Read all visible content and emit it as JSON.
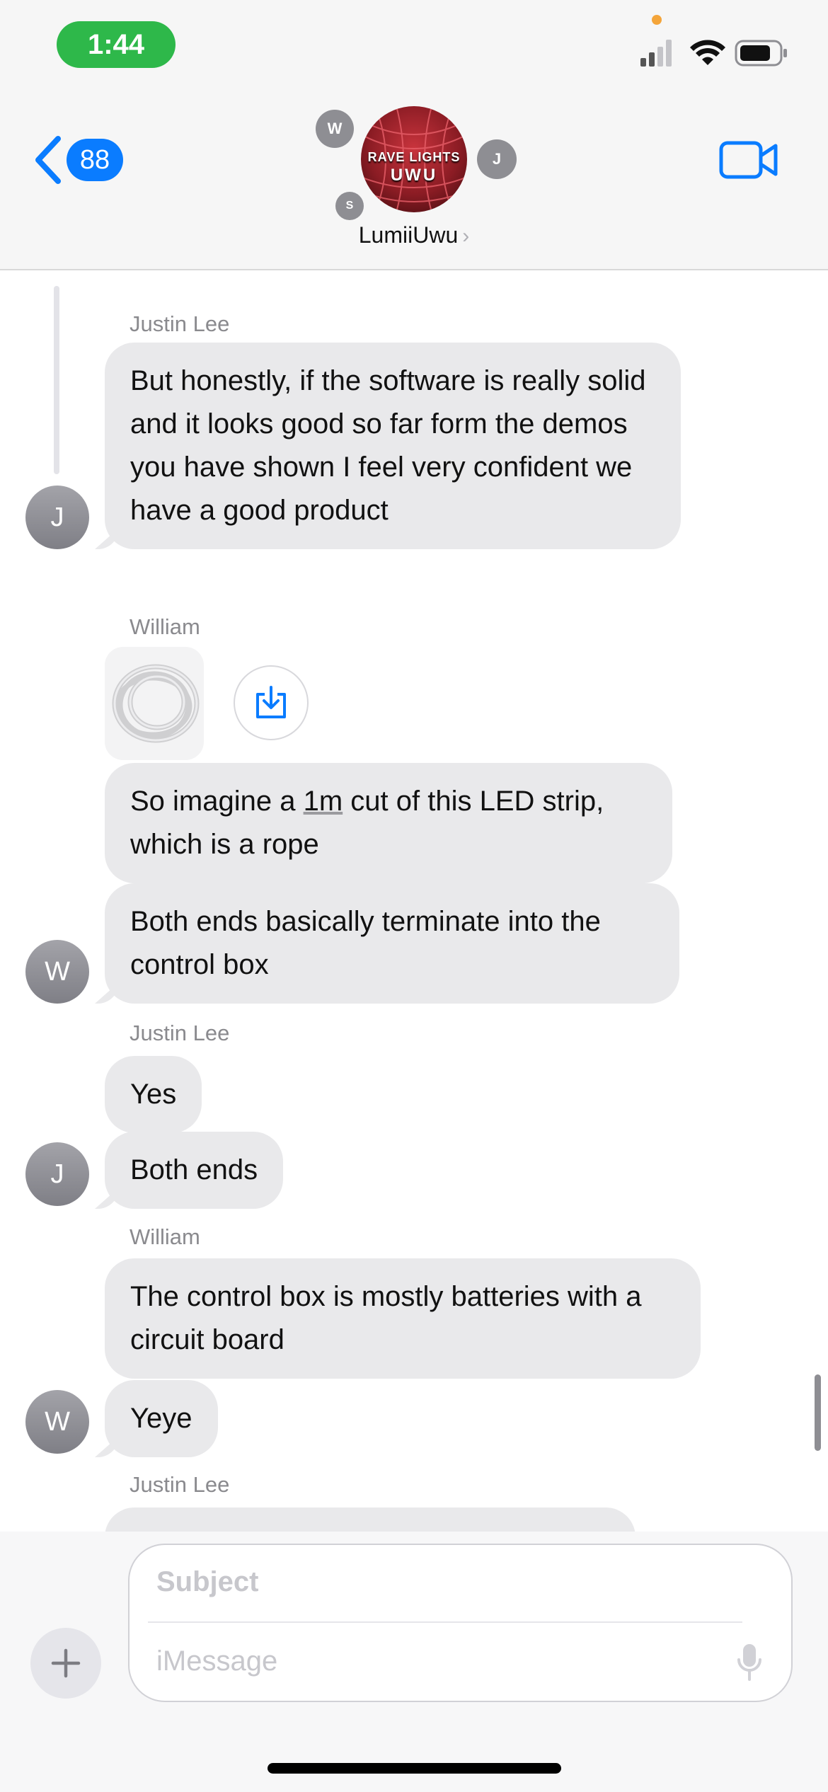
{
  "status_bar": {
    "time": "1:44"
  },
  "header": {
    "back_badge": "88",
    "group_name": "LumiiUwu",
    "group_avatar_line1": "RAVE LIGHTS",
    "group_avatar_line2": "UWU",
    "member_initials": [
      "W",
      "J",
      "S"
    ]
  },
  "messages": {
    "m1": {
      "sender": "Justin Lee",
      "text": "But honestly, if the software is really solid and it looks good so far form the demos you have shown I feel very confident we have a good product",
      "avatar": "J"
    },
    "m2": {
      "sender": "William",
      "text_before": "So imagine a ",
      "text_under": "1m",
      "text_after": " cut of this LED strip, which is a rope"
    },
    "m3": {
      "text": "Both ends basically terminate into the control box",
      "avatar": "W"
    },
    "m4": {
      "sender": "Justin Lee",
      "text": "Yes"
    },
    "m5": {
      "text": "Both ends",
      "avatar": "J"
    },
    "m6": {
      "sender": "William",
      "text": "The control box is mostly batteries with a circuit board"
    },
    "m7": {
      "text": "Yeye",
      "avatar": "W"
    },
    "m8": {
      "sender": "Justin Lee"
    }
  },
  "composer": {
    "subject_placeholder": "Subject",
    "message_placeholder": "iMessage"
  },
  "colors": {
    "accent": "#0a7cff",
    "bubble": "#e9e9eb",
    "time_pill": "#2eb84a"
  }
}
